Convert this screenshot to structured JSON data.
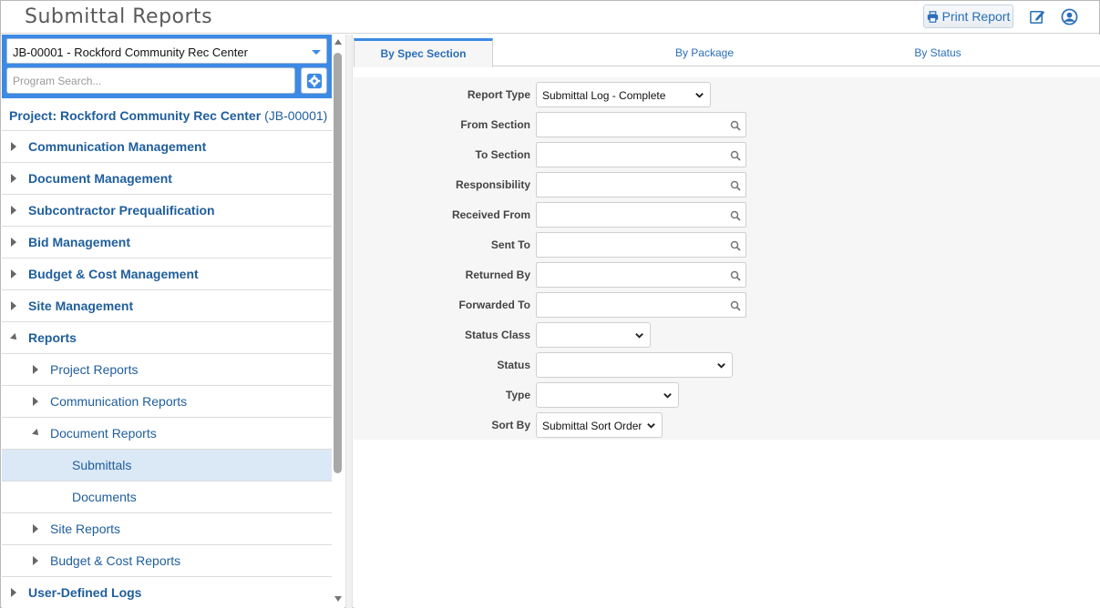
{
  "header": {
    "title": "Submittal Reports",
    "print_label": "Print Report",
    "colors": {
      "accent": "#3c8ae4",
      "link": "#1f5e9c"
    }
  },
  "sidebar": {
    "job_selected": "JB-00001 - Rockford Community Rec Center",
    "search_placeholder": "Program Search...",
    "project_label": "Project: Rockford Community Rec Center",
    "project_code": "(JB-00001)",
    "items": [
      {
        "label": "Communication Management",
        "level": 0,
        "state": "collapsed"
      },
      {
        "label": "Document Management",
        "level": 0,
        "state": "collapsed"
      },
      {
        "label": "Subcontractor Prequalification",
        "level": 0,
        "state": "collapsed"
      },
      {
        "label": "Bid Management",
        "level": 0,
        "state": "collapsed"
      },
      {
        "label": "Budget & Cost Management",
        "level": 0,
        "state": "collapsed"
      },
      {
        "label": "Site Management",
        "level": 0,
        "state": "collapsed"
      },
      {
        "label": "Reports",
        "level": 0,
        "state": "expanded"
      },
      {
        "label": "Project Reports",
        "level": 1,
        "state": "collapsed"
      },
      {
        "label": "Communication Reports",
        "level": 1,
        "state": "collapsed"
      },
      {
        "label": "Document Reports",
        "level": 1,
        "state": "expanded"
      },
      {
        "label": "Submittals",
        "level": 2,
        "state": "leaf",
        "selected": true
      },
      {
        "label": "Documents",
        "level": 2,
        "state": "leaf"
      },
      {
        "label": "Site Reports",
        "level": 1,
        "state": "collapsed"
      },
      {
        "label": "Budget & Cost Reports",
        "level": 1,
        "state": "collapsed"
      },
      {
        "label": "User-Defined Logs",
        "level": 0,
        "state": "collapsed"
      }
    ]
  },
  "tabs": [
    {
      "label": "By Spec Section",
      "active": true
    },
    {
      "label": "By Package",
      "active": false
    },
    {
      "label": "By Status",
      "active": false
    }
  ],
  "form": {
    "report_type": {
      "label": "Report Type",
      "value": "Submittal Log - Complete"
    },
    "from_section": {
      "label": "From Section",
      "value": ""
    },
    "to_section": {
      "label": "To Section",
      "value": ""
    },
    "responsibility": {
      "label": "Responsibility",
      "value": ""
    },
    "received_from": {
      "label": "Received From",
      "value": ""
    },
    "sent_to": {
      "label": "Sent To",
      "value": ""
    },
    "returned_by": {
      "label": "Returned By",
      "value": ""
    },
    "forwarded_to": {
      "label": "Forwarded To",
      "value": ""
    },
    "status_class": {
      "label": "Status Class",
      "value": ""
    },
    "status": {
      "label": "Status",
      "value": ""
    },
    "type": {
      "label": "Type",
      "value": ""
    },
    "sort_by": {
      "label": "Sort By",
      "value": "Submittal Sort Order"
    }
  }
}
